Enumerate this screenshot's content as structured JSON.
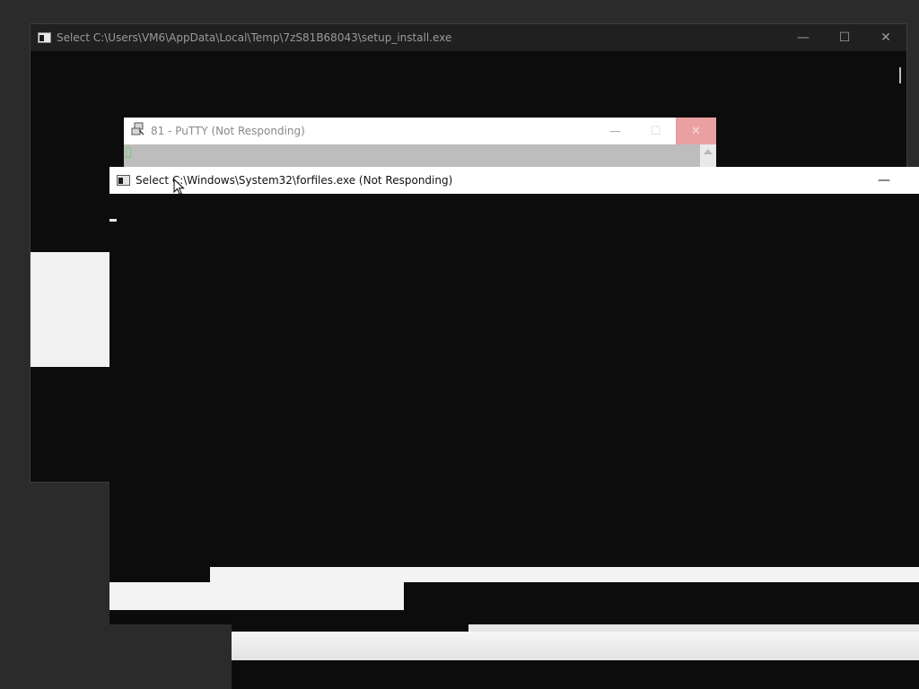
{
  "windows": {
    "setup_install": {
      "title": "Select C:\\Users\\VM6\\AppData\\Local\\Temp\\7zS81B68043\\setup_install.exe",
      "icon": "console-icon",
      "controls": {
        "minimize": "—",
        "maximize": "☐",
        "close": "✕"
      }
    },
    "putty": {
      "title": "81 - PuTTY (Not Responding)",
      "icon": "putty-icon",
      "controls": {
        "minimize": "—",
        "maximize": "☐",
        "close": "✕"
      }
    },
    "forfiles": {
      "title": "Select C:\\Windows\\System32\\forfiles.exe (Not Responding)",
      "icon": "console-icon",
      "controls": {
        "minimize": "—"
      }
    }
  },
  "colors": {
    "desktop": "#2b2b2b",
    "console_bg": "#0c0c0c",
    "putty_close_hover": "#eaa0a0"
  }
}
